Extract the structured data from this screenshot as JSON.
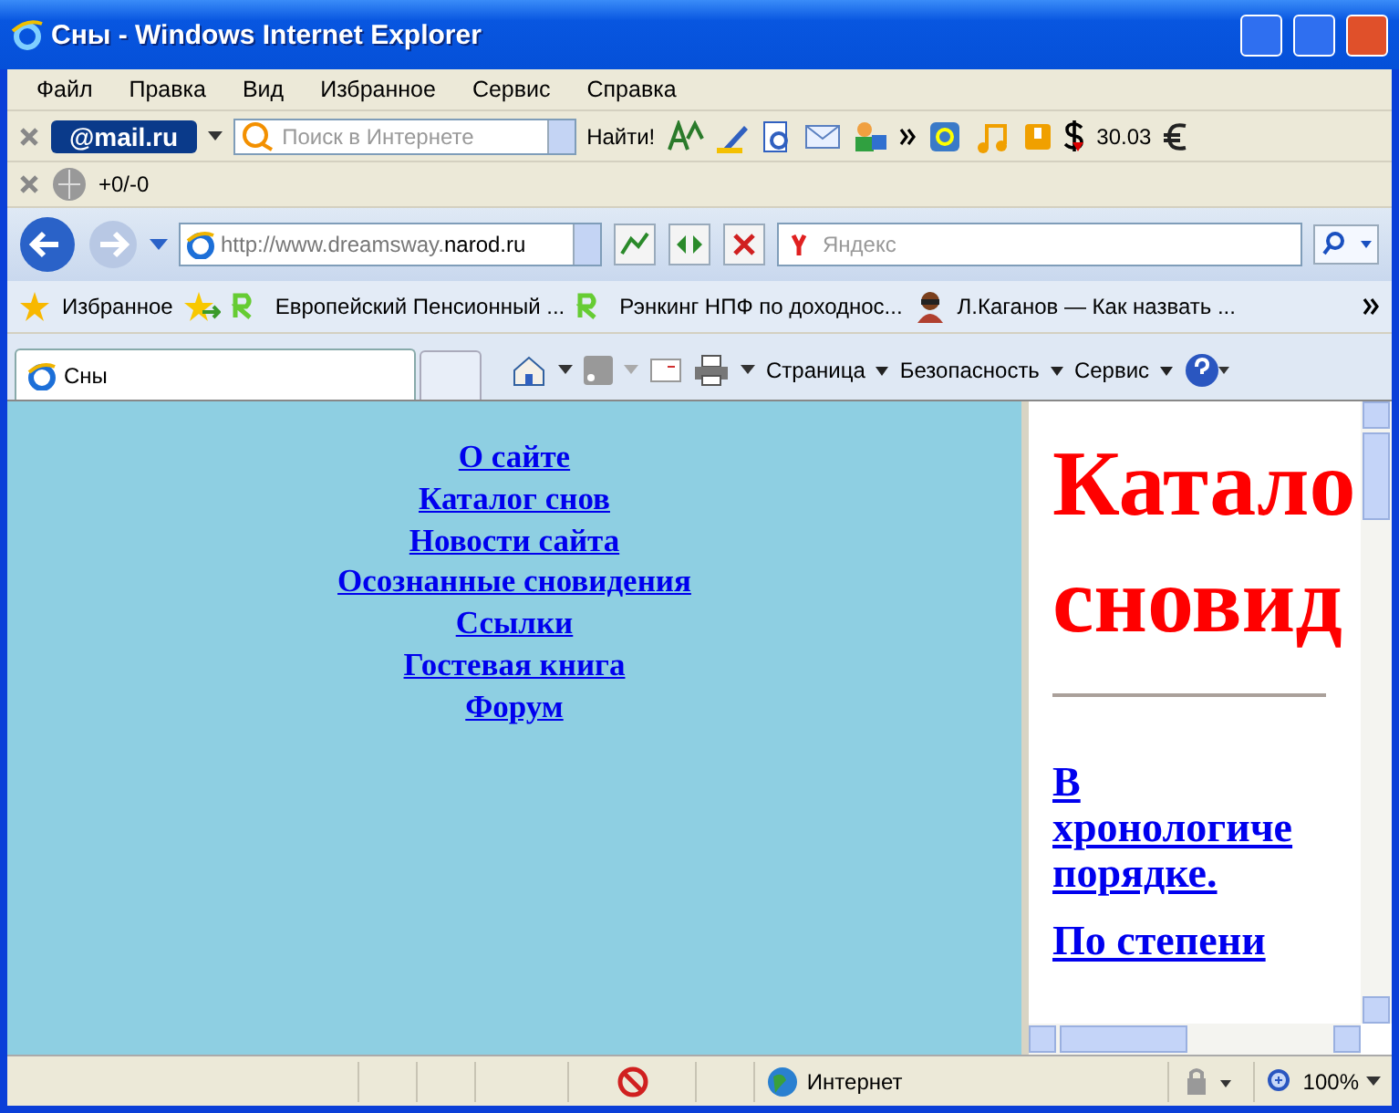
{
  "window": {
    "title": "Сны - Windows Internet Explorer"
  },
  "menu": [
    "Файл",
    "Правка",
    "Вид",
    "Избранное",
    "Сервис",
    "Справка"
  ],
  "mail_toolbar": {
    "logo": "@mail.ru",
    "search_placeholder": "Поиск в Интернете",
    "find": "Найти!",
    "currency": "30.03"
  },
  "counter_toolbar": {
    "counter": "+0/-0"
  },
  "address_bar": {
    "url_prefix": "http://www.dreamsway.",
    "url_domain": "narod.ru",
    "search_placeholder": "Яндекс"
  },
  "favorites_bar": {
    "label": "Избранное",
    "links": [
      {
        "text": "Европейский Пенсионный ...",
        "kind": "rm"
      },
      {
        "text": "Рэнкинг НПФ по доходнос...",
        "kind": "rm"
      },
      {
        "text": "Л.Каганов — Как назвать ...",
        "kind": "person"
      }
    ]
  },
  "tabs": [
    {
      "label": "Сны",
      "selected": true
    }
  ],
  "command_bar": [
    "Страница",
    "Безопасность",
    "Сервис"
  ],
  "left_frame": {
    "links": [
      "О сайте",
      "Каталог снов",
      "Новости сайта",
      "Осознанные сновидения",
      "Ссылки",
      "Гостевая книга",
      "Форум"
    ]
  },
  "right_frame": {
    "heading": [
      "Катало",
      "сновид"
    ],
    "links": [
      {
        "lines": [
          "В",
          "хронологиче",
          "порядке."
        ]
      },
      {
        "lines": [
          "По степени"
        ]
      }
    ]
  },
  "status_bar": {
    "zone": "Интернет",
    "zoom": "100%"
  }
}
